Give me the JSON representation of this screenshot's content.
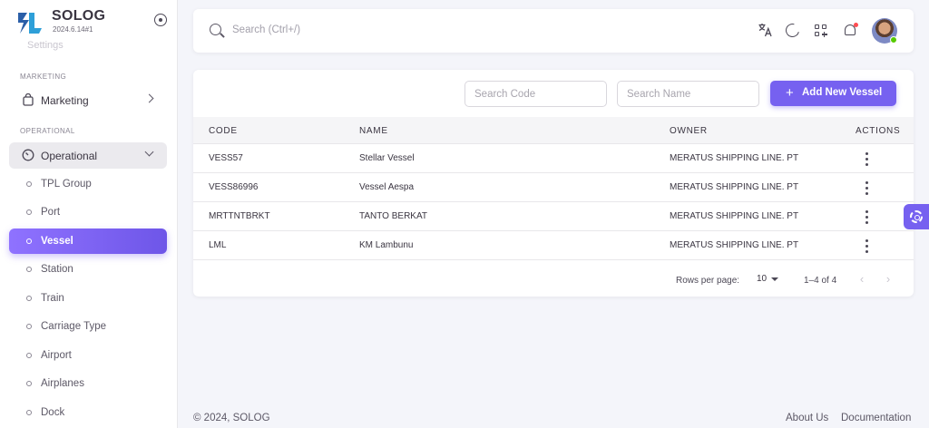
{
  "brand": {
    "name": "SOLOG",
    "version": "2024.6.14#1"
  },
  "sidebar": {
    "truncated_item": "Settings",
    "sections": [
      {
        "label": "MARKETING"
      },
      {
        "label": "OPERATIONAL"
      }
    ],
    "marketing": {
      "label": "Marketing"
    },
    "operational": {
      "label": "Operational",
      "children": [
        {
          "label": "TPL Group"
        },
        {
          "label": "Port"
        },
        {
          "label": "Vessel",
          "active": true
        },
        {
          "label": "Station"
        },
        {
          "label": "Train"
        },
        {
          "label": "Carriage Type"
        },
        {
          "label": "Airport"
        },
        {
          "label": "Airplanes"
        },
        {
          "label": "Dock"
        }
      ]
    }
  },
  "topbar": {
    "search_placeholder": "Search (Ctrl+/)",
    "icons": [
      "translate-icon",
      "moon-icon",
      "grid-add-icon",
      "bell-icon"
    ]
  },
  "toolbar": {
    "search_code_placeholder": "Search Code",
    "search_name_placeholder": "Search Name",
    "add_button_label": "Add New Vessel"
  },
  "table": {
    "columns": [
      "CODE",
      "NAME",
      "OWNER",
      "ACTIONS"
    ],
    "rows": [
      {
        "code": "VESS57",
        "name": "Stellar Vessel",
        "owner": "MERATUS SHIPPING LINE. PT"
      },
      {
        "code": "VESS86996",
        "name": "Vessel Aespa",
        "owner": "MERATUS SHIPPING LINE. PT"
      },
      {
        "code": "MRTTNTBRKT",
        "name": "TANTO BERKAT",
        "owner": "MERATUS SHIPPING LINE. PT"
      },
      {
        "code": "LML",
        "name": "KM Lambunu",
        "owner": "MERATUS SHIPPING LINE. PT"
      }
    ],
    "pagination": {
      "rows_per_page_label": "Rows per page:",
      "rows_per_page": "10",
      "range": "1–4 of 4"
    }
  },
  "footer": {
    "copyright": "© 2024, SOLOG",
    "links": [
      "About Us",
      "Documentation"
    ]
  },
  "colors": {
    "accent": "#7661f0",
    "active_gradient_start": "#8f72ff",
    "status_online": "#56ca00",
    "notification": "#ff4c51"
  }
}
